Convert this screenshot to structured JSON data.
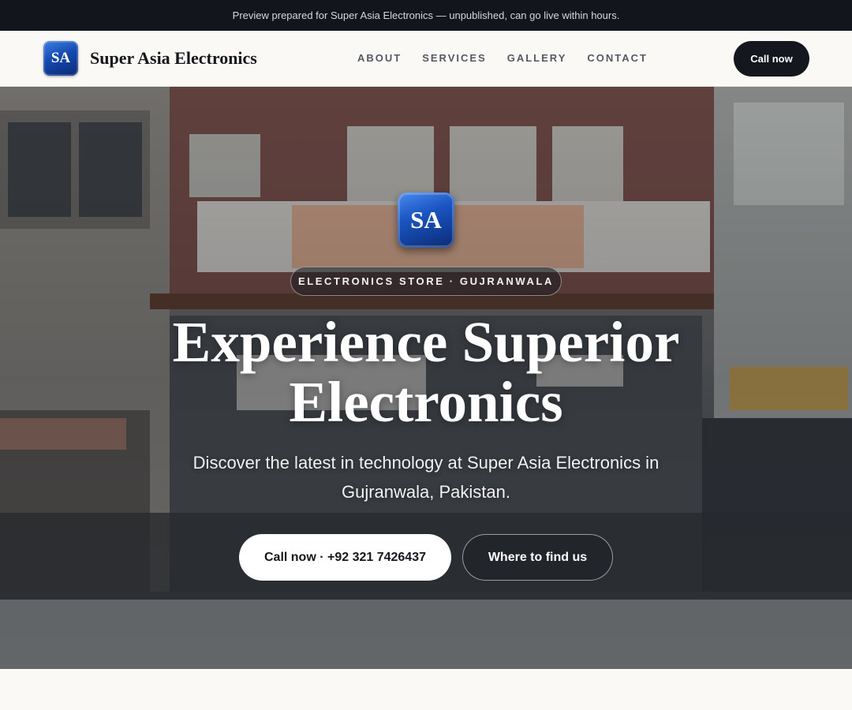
{
  "banner": {
    "text": "Preview prepared for Super Asia Electronics — unpublished, can go live within hours."
  },
  "header": {
    "logo_text": "SA",
    "brand": "Super Asia Electronics",
    "nav": [
      {
        "label": "ABOUT"
      },
      {
        "label": "SERVICES"
      },
      {
        "label": "GALLERY"
      },
      {
        "label": "CONTACT"
      }
    ],
    "cta_label": "Call now"
  },
  "hero": {
    "logo_text": "SA",
    "tag": "ELECTRONICS STORE · GUJRANWALA",
    "title": "Experience Superior Electronics",
    "subtitle": "Discover the latest in technology at Super Asia Electronics in Gujranwala, Pakistan.",
    "primary_cta": "Call now · +92 321 7426437",
    "secondary_cta": "Where to find us",
    "background_description_icon": "storefront-street-photo"
  },
  "colors": {
    "banner_bg": "#12151b",
    "page_bg": "#faf9f6",
    "brand_blue": "#1549b0",
    "dark_button": "#14171d",
    "nav_text": "#545a64"
  }
}
